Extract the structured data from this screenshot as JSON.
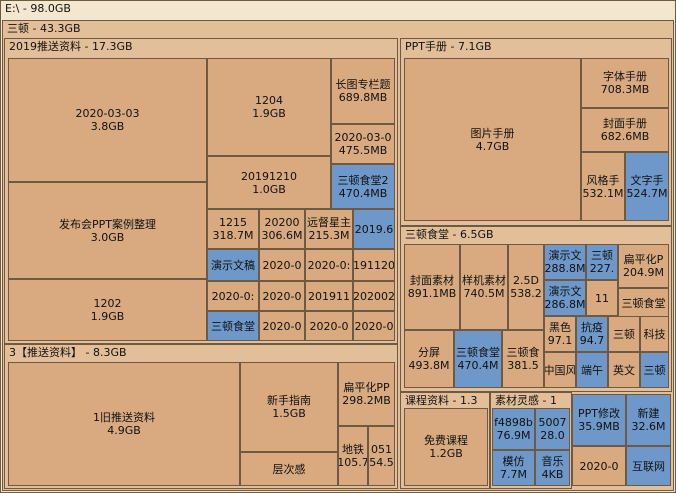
{
  "window": {
    "drive_label": "E:\\ - 98.0GB"
  },
  "level1": {
    "label": "三顿 - 43.3GB"
  },
  "groups": {
    "g2019": "2019推送资料 - 17.3GB",
    "gppt": "PPT手册 - 7.1GB",
    "gfood": "三顿食堂 - 6.5GB",
    "g3": "3【推送资料】 - 8.3GB",
    "gcourse": "课程资料 - 1.3",
    "gmat": "素材灵感 - 1"
  },
  "blocks": {
    "b1": [
      "2020-03-03",
      "3.8GB"
    ],
    "b2": [
      "发布会PPT案例整理",
      "3.0GB"
    ],
    "b3": [
      "1202",
      "1.9GB"
    ],
    "b4": [
      "1204",
      "1.9GB"
    ],
    "b5": [
      "长图专栏题",
      "689.8MB"
    ],
    "b6": [
      "2020-03-0",
      "475.5MB"
    ],
    "b7": [
      "三顿食堂2",
      "470.4MB"
    ],
    "b8": [
      "20191210",
      "1.0GB"
    ],
    "b9": [
      "1215",
      "318.7M"
    ],
    "b10": [
      "20200",
      "306.6M"
    ],
    "b11": [
      "远督星主",
      "215.3M"
    ],
    "b12": [
      "2019.6"
    ],
    "b13": [
      "演示文稿"
    ],
    "b14": [
      "2020-0"
    ],
    "b15": [
      "2020-0:"
    ],
    "b16": [
      "191120"
    ],
    "b17": [
      "2020-0:"
    ],
    "b18": [
      "2020-0"
    ],
    "b19": [
      "201911"
    ],
    "b20": [
      "202002"
    ],
    "b21": [
      "三顿食堂"
    ],
    "b22": [
      "2020-0"
    ],
    "b23": [
      "2020-0"
    ],
    "b24": [
      "2020-0"
    ],
    "b25": [
      "图片手册",
      "4.7GB"
    ],
    "b26": [
      "字体手册",
      "708.3MB"
    ],
    "b27": [
      "封面手册",
      "682.6MB"
    ],
    "b28": [
      "风格手",
      "532.1M"
    ],
    "b29": [
      "文字手",
      "524.7M"
    ],
    "b30": [
      "封面素材",
      "891.1MB"
    ],
    "b31": [
      "样机素材",
      "740.5M"
    ],
    "b32": [
      "2.5D",
      "538.2"
    ],
    "b33": [
      "演示文",
      "288.8M"
    ],
    "b34": [
      "三顿",
      "227."
    ],
    "b35": [
      "扁平化P",
      "204.9M"
    ],
    "b36": [
      "演示文",
      "286.8M"
    ],
    "b37": [
      "11"
    ],
    "b38": [
      "三顿食堂"
    ],
    "b39": [
      "黑色",
      "97.1"
    ],
    "b40": [
      "抗疫",
      "94.7"
    ],
    "b41": [
      "三顿"
    ],
    "b42": [
      "科技"
    ],
    "b43": [
      "分屏",
      "493.8M"
    ],
    "b44": [
      "三顿食堂",
      "470.4M"
    ],
    "b45": [
      "三顿食",
      "381.5"
    ],
    "b46": [
      "中国风"
    ],
    "b47": [
      "端午"
    ],
    "b48": [
      "英文"
    ],
    "b49": [
      "三顿"
    ],
    "b50": [
      "1旧推送资料",
      "4.9GB"
    ],
    "b51": [
      "新手指南",
      "1.5GB"
    ],
    "b52": [
      "扁平化PP",
      "298.2MB"
    ],
    "b53": [
      "层次感"
    ],
    "b54": [
      "地铁",
      "105.7"
    ],
    "b55": [
      "051",
      "54.5"
    ],
    "b56": [
      "免费课程",
      "1.2GB"
    ],
    "b57": [
      "f4898b",
      "76.9M"
    ],
    "b58": [
      "5007",
      "28.0"
    ],
    "b59": [
      "模仿",
      "7.7M"
    ],
    "b60": [
      "音乐",
      "4KB"
    ],
    "b61": [
      "PPT修改",
      "35.9MB"
    ],
    "b62": [
      "新建",
      "32.6M"
    ],
    "b63": [
      "2020-0"
    ],
    "b64": [
      "互联网"
    ]
  },
  "colors": {
    "tan": "#d9aa80",
    "blue": "#6d98c9",
    "container": "#e2bf99",
    "border": "#6e5a42"
  }
}
